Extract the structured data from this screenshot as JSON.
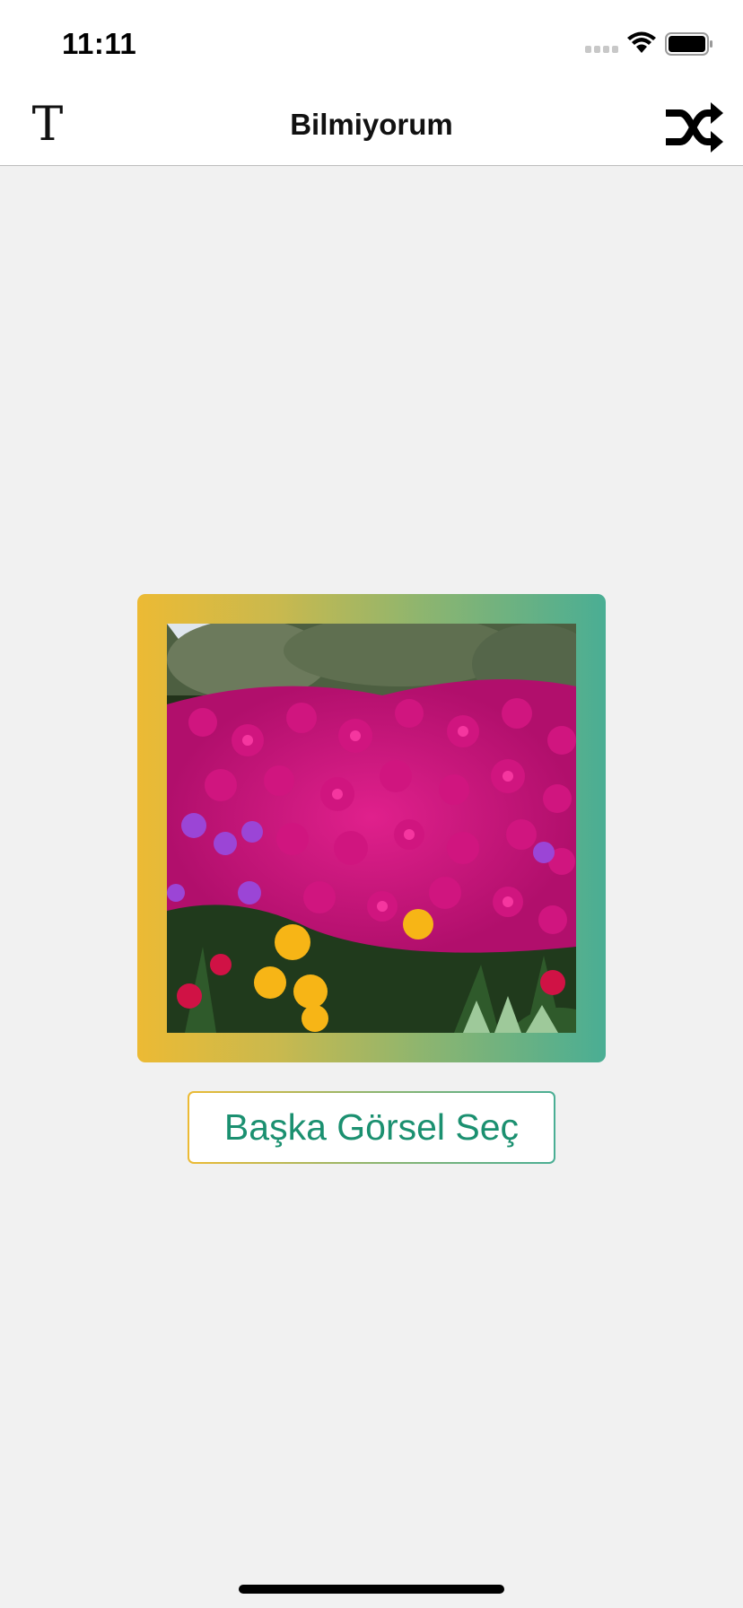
{
  "status_bar": {
    "time": "11:11",
    "icons": [
      "cellular-signal-icon",
      "wifi-icon",
      "battery-icon"
    ]
  },
  "nav": {
    "title": "Bilmiyorum",
    "left_icon": "text-format-icon",
    "left_glyph": "T",
    "right_icon": "shuffle-icon"
  },
  "image": {
    "description_icon": "flower-photo"
  },
  "buttons": {
    "pick_image_label": "Başka Görsel Seç"
  },
  "colors": {
    "background": "#f1f1f1",
    "gradient_start": "#ecba34",
    "gradient_mid": "#8fb56e",
    "gradient_end": "#4aae94",
    "button_text": "#1b9070"
  }
}
